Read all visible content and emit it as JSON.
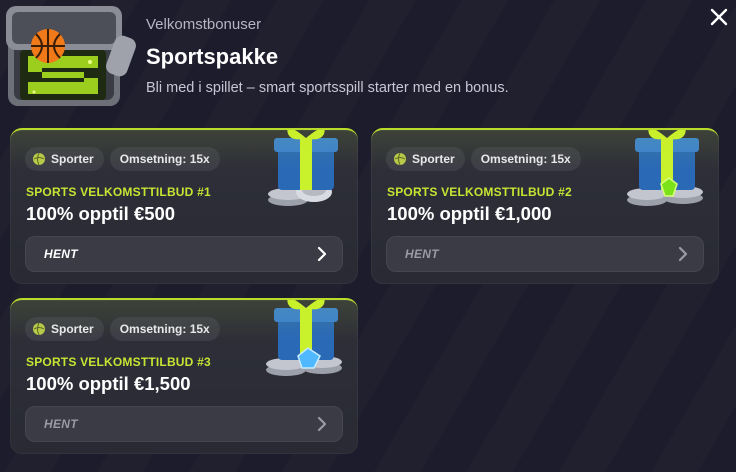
{
  "header": {
    "subtitle": "Velkomstbonuser",
    "title": "Sportspakke",
    "description": "Bli med i spillet – smart sportsspill starter med en bonus."
  },
  "colors": {
    "accent": "#c6e532",
    "background": "#1d1c2c",
    "card": "#2f303a"
  },
  "offers": [
    {
      "tag_sport": "Sporter",
      "tag_wager": "Omsetning: 15x",
      "label": "SPORTS VELKOMSTTILBUD #1",
      "amount": "100% opptil €500",
      "claim": "HENT",
      "gem": "none"
    },
    {
      "tag_sport": "Sporter",
      "tag_wager": "Omsetning: 15x",
      "label": "SPORTS VELKOMSTTILBUD #2",
      "amount": "100% opptil €1,000",
      "claim": "HENT",
      "gem": "green"
    },
    {
      "tag_sport": "Sporter",
      "tag_wager": "Omsetning: 15x",
      "label": "SPORTS VELKOMSTTILBUD #3",
      "amount": "100% opptil €1,500",
      "claim": "HENT",
      "gem": "blue"
    }
  ]
}
